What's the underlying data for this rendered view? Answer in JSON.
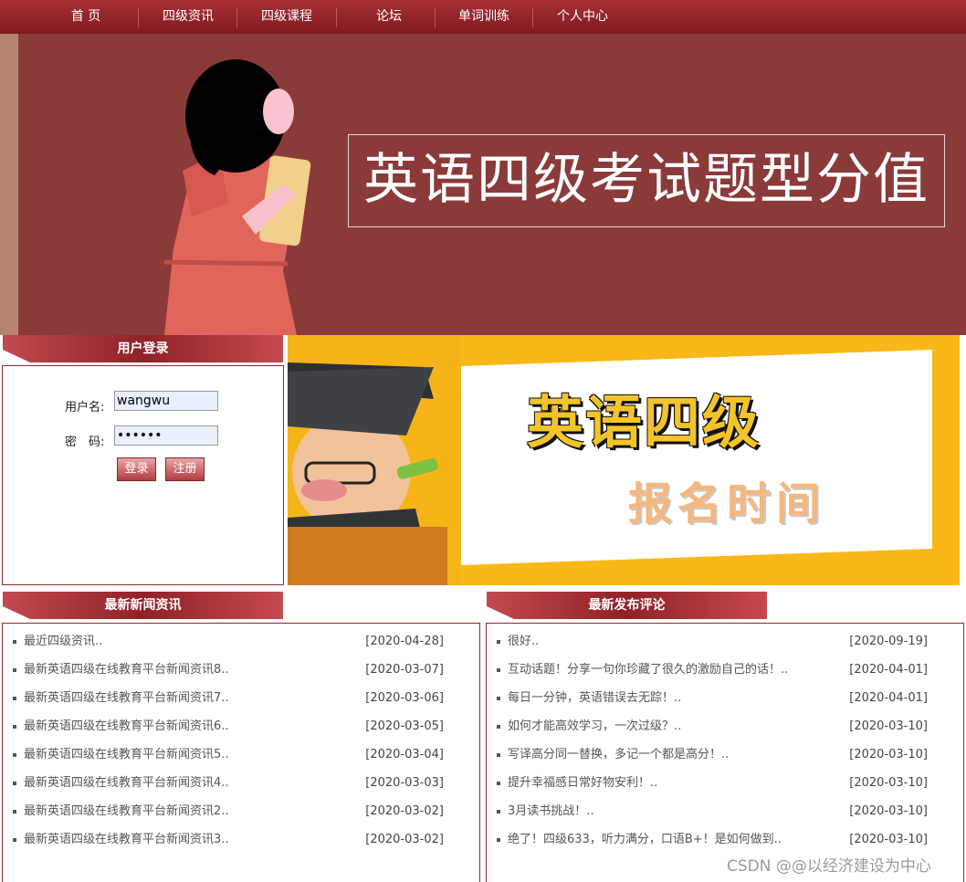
{
  "nav": {
    "items": [
      "首 页",
      "四级资讯",
      "四级课程",
      "论坛",
      "单词训练",
      "个人中心"
    ]
  },
  "banner": {
    "title": "英语四级考试题型分值"
  },
  "login": {
    "heading": "用户登录",
    "username_label": "用户名:",
    "username_value": "wangwu",
    "password_label": "密　码:",
    "password_value": "••••••",
    "login_button": "登录",
    "register_button": "注册"
  },
  "ad": {
    "title": "英语四级",
    "subtitle": "报名时间"
  },
  "news": {
    "heading": "最新新闻资讯",
    "items": [
      {
        "title": "最近四级资讯..",
        "date": "[2020-04-28]"
      },
      {
        "title": "最新英语四级在线教育平台新闻资讯8..",
        "date": "[2020-03-07]"
      },
      {
        "title": "最新英语四级在线教育平台新闻资讯7..",
        "date": "[2020-03-06]"
      },
      {
        "title": "最新英语四级在线教育平台新闻资讯6..",
        "date": "[2020-03-05]"
      },
      {
        "title": "最新英语四级在线教育平台新闻资讯5..",
        "date": "[2020-03-04]"
      },
      {
        "title": "最新英语四级在线教育平台新闻资讯4..",
        "date": "[2020-03-03]"
      },
      {
        "title": "最新英语四级在线教育平台新闻资讯2..",
        "date": "[2020-03-02]"
      },
      {
        "title": "最新英语四级在线教育平台新闻资讯3..",
        "date": "[2020-03-02]"
      }
    ]
  },
  "comments": {
    "heading": "最新发布评论",
    "items": [
      {
        "title": "很好..",
        "date": "[2020-09-19]"
      },
      {
        "title": "互动话题！分享一句你珍藏了很久的激励自己的话！..",
        "date": "[2020-04-01]"
      },
      {
        "title": "每日一分钟，英语错误去无踪！..",
        "date": "[2020-04-01]"
      },
      {
        "title": "如何才能高效学习，一次过级？..",
        "date": "[2020-03-10]"
      },
      {
        "title": "写译高分同一替换，多记一个都是高分！..",
        "date": "[2020-03-10]"
      },
      {
        "title": "提升幸福感日常好物安利！..",
        "date": "[2020-03-10]"
      },
      {
        "title": "3月读书挑战！..",
        "date": "[2020-03-10]"
      },
      {
        "title": "绝了！四级633，听力满分，口语B+！是如何做到..",
        "date": "[2020-03-10]"
      }
    ]
  },
  "watermark": "CSDN @@以经济建设为中心"
}
